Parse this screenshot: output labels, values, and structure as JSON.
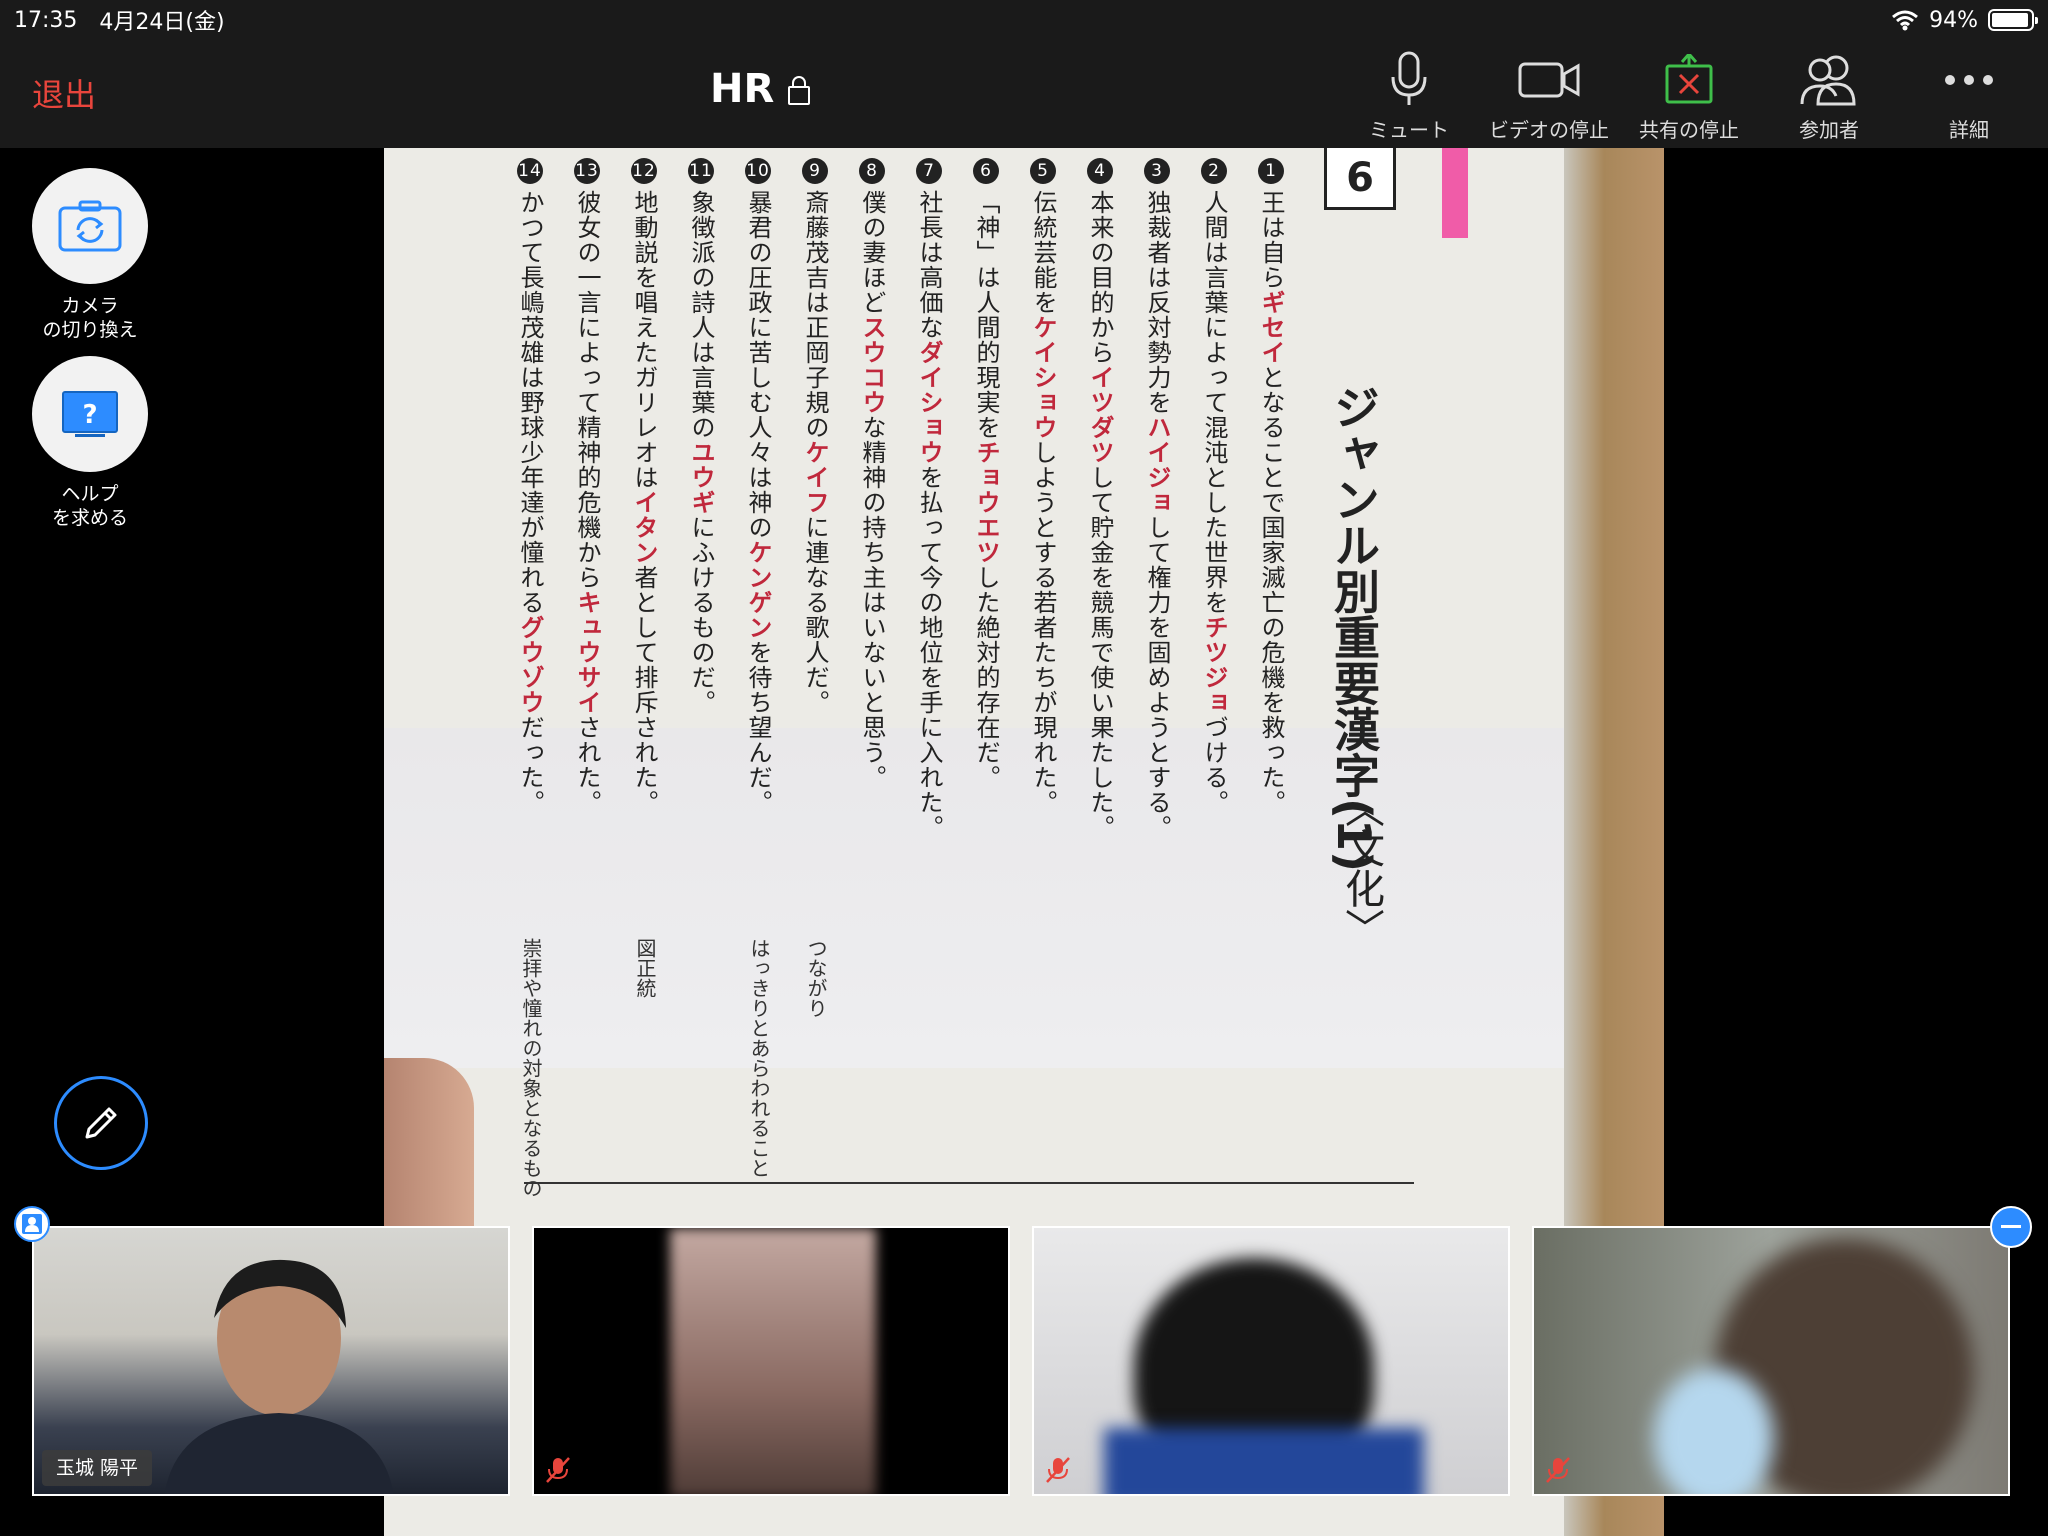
{
  "status_bar": {
    "time": "17:35",
    "date": "4月24日(金)",
    "battery": "94%",
    "battery_level": 0.94
  },
  "toolbar": {
    "leave_label": "退出",
    "meeting_title": "HR",
    "buttons": [
      {
        "label": "ミュート",
        "icon": "microphone-icon"
      },
      {
        "label": "ビデオの停止",
        "icon": "video-camera-icon"
      },
      {
        "label": "共有の停止",
        "icon": "stop-share-icon"
      },
      {
        "label": "参加者",
        "icon": "participants-icon"
      },
      {
        "label": "詳細",
        "icon": "more-icon"
      }
    ]
  },
  "side_buttons": {
    "camera_switch": {
      "line1": "カメラ",
      "line2": "の切り換え",
      "icon": "camera-switch-icon"
    },
    "help": {
      "line1": "ヘルプ",
      "line2": "を求める",
      "icon": "help-icon"
    },
    "annotate_icon": "pencil-icon"
  },
  "shared_content": {
    "chapter_number": "6",
    "heading": "ジャンル別重要漢字(1)",
    "subheading": "〈文化〉",
    "colors": {
      "accent": "#c0283c",
      "tab": "#f05ca8"
    },
    "sentences": [
      {
        "num": "1",
        "pre": "王は自ら",
        "kw": "ギセイ",
        "post": "となることで国家滅亡の危機を救った。"
      },
      {
        "num": "2",
        "pre": "人間は言葉によって混沌とした世界を",
        "kw": "チツジョ",
        "post": "づける。"
      },
      {
        "num": "3",
        "pre": "独裁者は反対勢力を",
        "kw": "ハイジョ",
        "post": "して権力を固めようとする。"
      },
      {
        "num": "4",
        "pre": "本来の目的から",
        "kw": "イツダツ",
        "post": "して貯金を競馬で使い果たした。"
      },
      {
        "num": "5",
        "pre": "伝統芸能を",
        "kw": "ケイショウ",
        "post": "しようとする若者たちが現れた。"
      },
      {
        "num": "6",
        "pre": "「神」は人間的現実を",
        "kw": "チョウエツ",
        "post": "した絶対的存在だ。"
      },
      {
        "num": "7",
        "pre": "社長は高価な",
        "kw": "ダイショウ",
        "post": "を払って今の地位を手に入れた。"
      },
      {
        "num": "8",
        "pre": "僕の妻ほど",
        "kw": "スウコウ",
        "post": "な精神の持ち主はいないと思う。"
      },
      {
        "num": "9",
        "pre": "斎藤茂吉は正岡子規の",
        "kw": "ケイフ",
        "post": "に連なる歌人だ。"
      },
      {
        "num": "10",
        "pre": "暴君の圧政に苦しむ人々は神の",
        "kw": "ケンゲン",
        "post": "を待ち望んだ。"
      },
      {
        "num": "11",
        "pre": "象徴派の詩人は言葉の",
        "kw": "ユウギ",
        "post": "にふけるものだ。"
      },
      {
        "num": "12",
        "pre": "地動説を唱えたガリレオは",
        "kw": "イタン",
        "post": "者として排斥された。"
      },
      {
        "num": "13",
        "pre": "彼女の一言によって精神的危機から",
        "kw": "キュウサイ",
        "post": "された。"
      },
      {
        "num": "14",
        "pre": "かつて長嶋茂雄は野球少年達が憧れる",
        "kw": "グウゾウ",
        "post": "だった。"
      }
    ],
    "notes": [
      {
        "row": 9,
        "text": "つながり"
      },
      {
        "row": 10,
        "text": "はっきりとあらわれること"
      },
      {
        "row": 12,
        "text": "図正統"
      },
      {
        "row": 14,
        "text": "崇拝や憧れの対象となるもの"
      }
    ]
  },
  "participants": [
    {
      "name": "玉城 陽平",
      "muted": false,
      "pinned": true
    },
    {
      "name": "",
      "muted": true
    },
    {
      "name": "",
      "muted": true
    },
    {
      "name": "",
      "muted": true
    }
  ]
}
